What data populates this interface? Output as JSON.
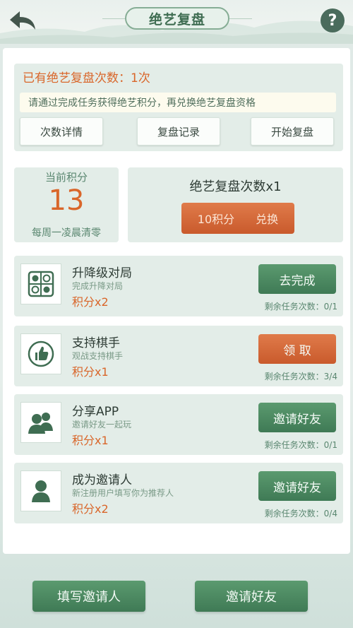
{
  "header": {
    "title": "绝艺复盘",
    "help_label": "?"
  },
  "summary": {
    "count_text": "已有绝艺复盘次数：1次",
    "notice": "请通过完成任务获得绝艺积分，再兑换绝艺复盘资格",
    "buttons": [
      "次数详情",
      "复盘记录",
      "开始复盘"
    ]
  },
  "points": {
    "label": "当前积分",
    "value": "13",
    "sub": "每周一凌晨清零"
  },
  "exchange": {
    "title": "绝艺复盘次数x1",
    "cost": "10积分",
    "action": "兑换"
  },
  "tasks": [
    {
      "icon": "board-icon",
      "name": "升降级对局",
      "desc": "完成升降对局",
      "reward": "积分x2",
      "button": "去完成",
      "button_color": "#4a875f",
      "remaining": "剩余任务次数：0/1"
    },
    {
      "icon": "thumbs-up-icon",
      "name": "支持棋手",
      "desc": "观战支持棋手",
      "reward": "积分x1",
      "button": "领 取",
      "button_color": "#d2653a",
      "remaining": "剩余任务次数：3/4"
    },
    {
      "icon": "users-icon",
      "name": "分享APP",
      "desc": "邀请好友一起玩",
      "reward": "积分x1",
      "button": "邀请好友",
      "button_color": "#4a875f",
      "remaining": "剩余任务次数：0/1"
    },
    {
      "icon": "user-icon",
      "name": "成为邀请人",
      "desc": "新注册用户填写你为推荐人",
      "reward": "积分x2",
      "button": "邀请好友",
      "button_color": "#4a875f",
      "remaining": "剩余任务次数：0/4"
    }
  ],
  "footer": {
    "left_button": "填写邀请人",
    "right_button": "邀请好友"
  },
  "colors": {
    "accent_orange": "#d9662a",
    "accent_green": "#4a875f",
    "panel": "#e3ede8"
  }
}
